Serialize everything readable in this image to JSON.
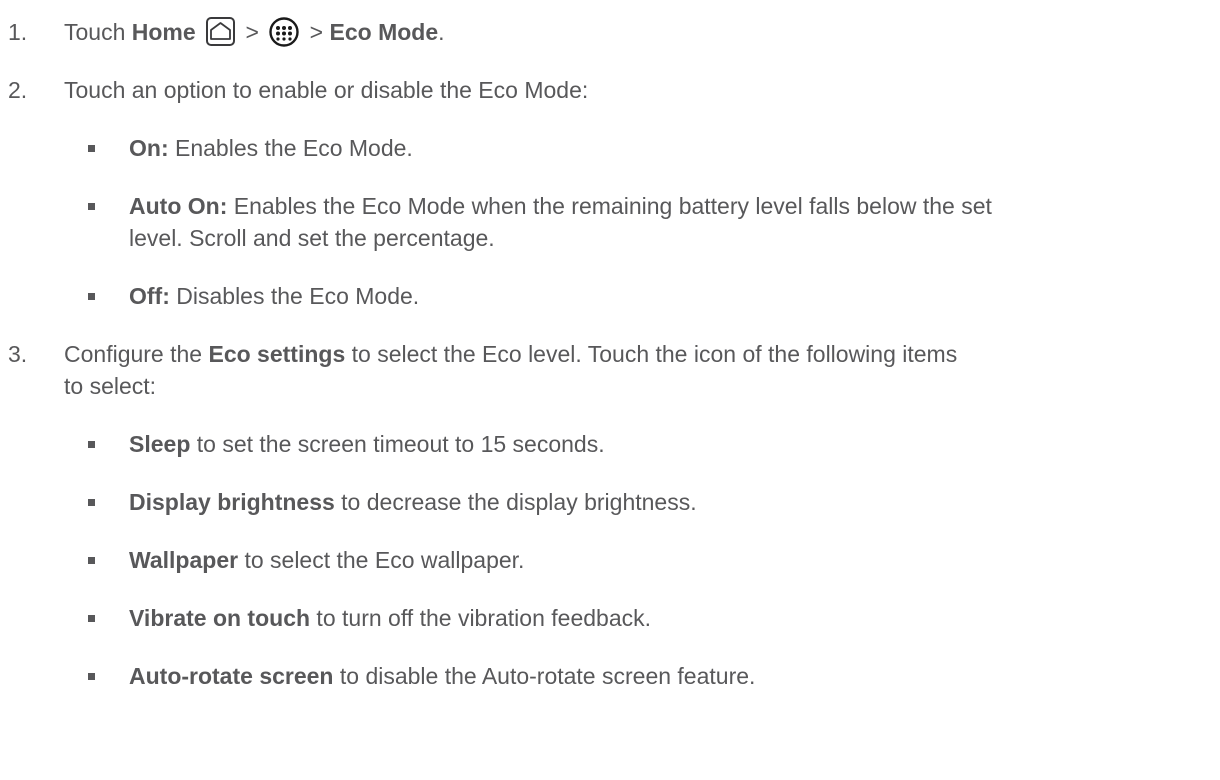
{
  "steps": [
    {
      "number": "1.",
      "parts": {
        "prefix": "Touch ",
        "home": "Home",
        "sep1": " > ",
        "sep2": " > ",
        "eco_mode": "Eco Mode",
        "end": "."
      },
      "icons": [
        "home-icon",
        "apps-icon"
      ]
    },
    {
      "number": "2.",
      "text": "Touch an option to enable or disable the Eco Mode:",
      "options": [
        {
          "label": "On:",
          "text": " Enables the Eco Mode."
        },
        {
          "label": "Auto On:",
          "text": " Enables the Eco Mode when the remaining battery level falls below the set",
          "text2": "level. Scroll and set the percentage."
        },
        {
          "label": "Off:",
          "text": " Disables the Eco Mode."
        }
      ]
    },
    {
      "number": "3.",
      "prefix": "Configure the ",
      "bold": "Eco settings",
      "suffix": " to select the Eco level. Touch the icon of the following items",
      "line2": "to select:",
      "items": [
        {
          "label": "Sleep",
          "text": " to set the screen timeout to 15 seconds."
        },
        {
          "label": "Display brightness",
          "text": " to decrease the display brightness."
        },
        {
          "label": "Wallpaper",
          "text": " to select the Eco wallpaper."
        },
        {
          "label": "Vibrate on touch",
          "text": " to turn off the vibration feedback."
        },
        {
          "label": "Auto-rotate screen",
          "text": " to disable the Auto-rotate screen feature."
        }
      ]
    }
  ],
  "colors": {
    "text": "#58585a"
  }
}
